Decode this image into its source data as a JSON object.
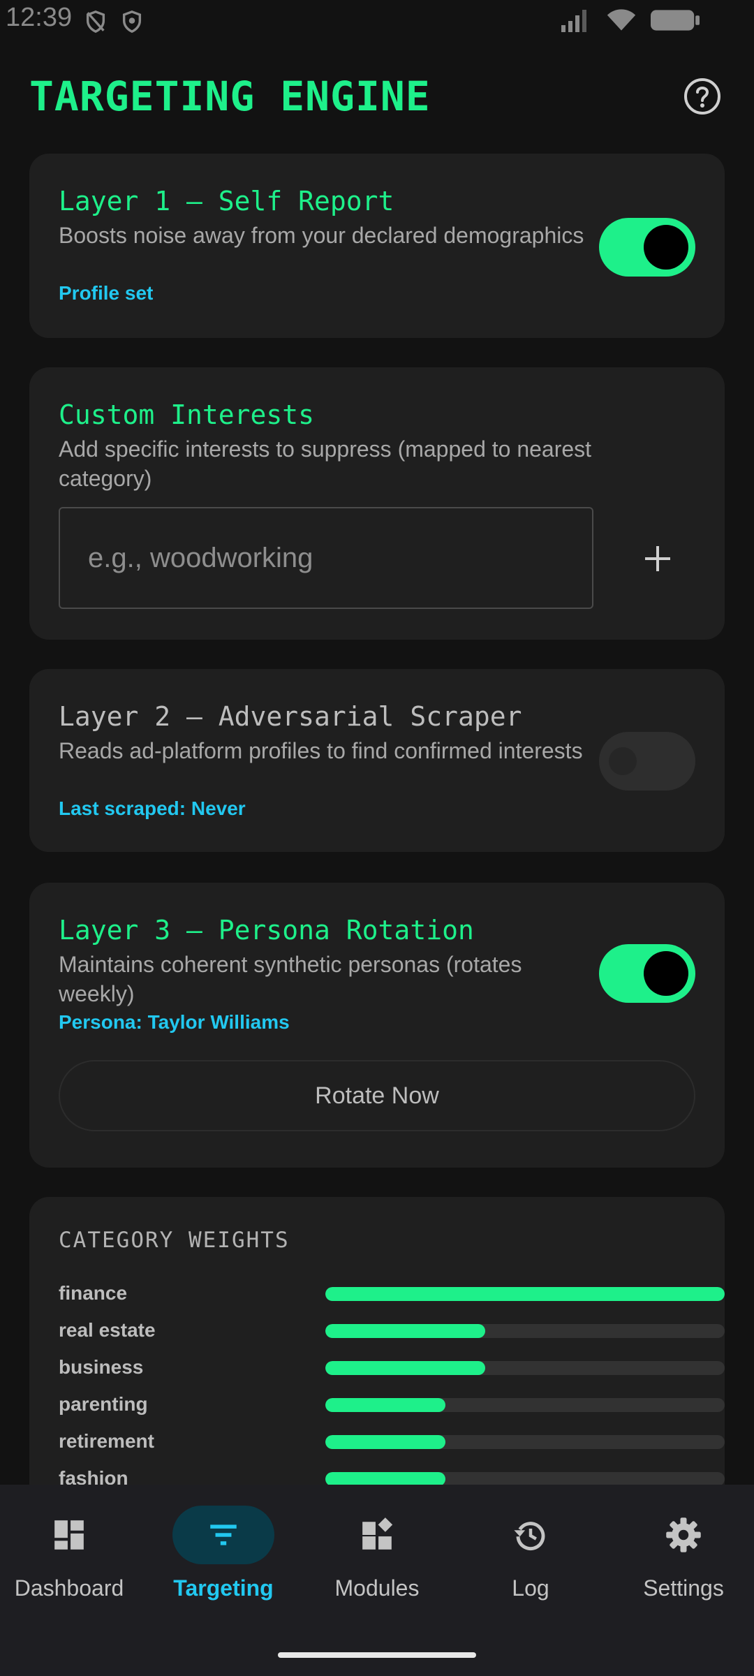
{
  "status_bar": {
    "time": "12:39",
    "icons": [
      "shield-off-icon",
      "shield-icon",
      "signal-icon",
      "wifi-icon",
      "battery-icon"
    ]
  },
  "header": {
    "title": "TARGETING ENGINE",
    "help_icon": "help-circle-icon"
  },
  "layer1": {
    "title": "Layer 1 — Self Report",
    "description": "Boosts noise away from your declared demographics",
    "status": "Profile set",
    "enabled": true
  },
  "custom_interests": {
    "title": "Custom Interests",
    "description": "Add specific interests to suppress (mapped to nearest category)",
    "input_value": "",
    "input_placeholder": "e.g., woodworking",
    "add_icon": "plus-icon"
  },
  "layer2": {
    "title": "Layer 2 — Adversarial Scraper",
    "description": "Reads ad-platform profiles to find confirmed interests",
    "status": "Last scraped: Never",
    "enabled": false
  },
  "layer3": {
    "title": "Layer 3 — Persona Rotation",
    "description": "Maintains coherent synthetic personas (rotates weekly)",
    "status": "Persona: Taylor Williams",
    "enabled": true,
    "rotate_label": "Rotate Now"
  },
  "category_weights": {
    "title": "CATEGORY WEIGHTS",
    "items": [
      {
        "label": "finance",
        "weight": 1.0
      },
      {
        "label": "real estate",
        "weight": 0.4
      },
      {
        "label": "business",
        "weight": 0.4
      },
      {
        "label": "parenting",
        "weight": 0.3
      },
      {
        "label": "retirement",
        "weight": 0.3
      },
      {
        "label": "fashion",
        "weight": 0.3
      }
    ]
  },
  "colors": {
    "accent_green": "#1ef08a",
    "accent_cyan": "#22c8f0",
    "background": "#121212",
    "card": "#1f1f1f"
  },
  "bottom_nav": {
    "active": "Targeting",
    "items": [
      {
        "label": "Dashboard",
        "icon": "dashboard-icon"
      },
      {
        "label": "Targeting",
        "icon": "filter-icon"
      },
      {
        "label": "Modules",
        "icon": "widgets-icon"
      },
      {
        "label": "Log",
        "icon": "history-icon"
      },
      {
        "label": "Settings",
        "icon": "gear-icon"
      }
    ]
  }
}
